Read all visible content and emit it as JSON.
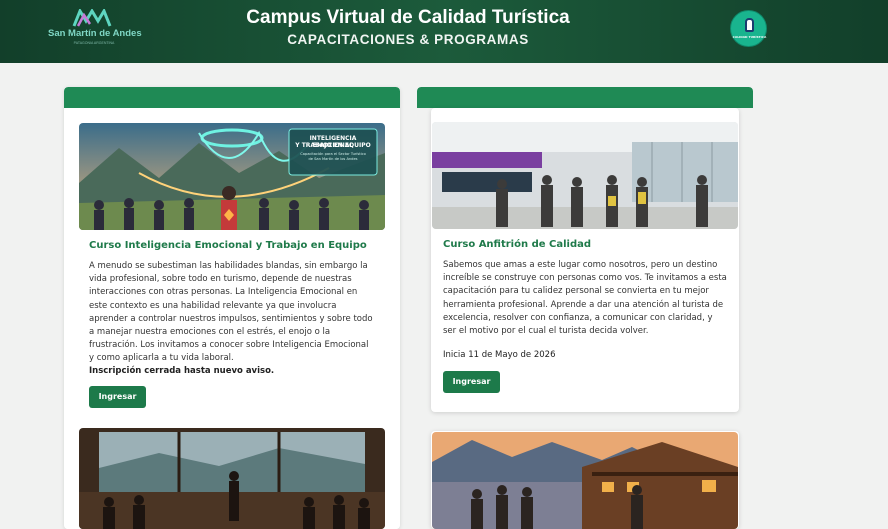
{
  "header": {
    "brand": "San Martín de Andes",
    "brand_sub": "PATAGONIA ARGENTINA",
    "title": "Campus Virtual de Calidad Turística",
    "subtitle": "CAPACITACIONES & PROGRAMAS",
    "badge_text": "CALIDAD TURÍSTICA"
  },
  "courses": [
    {
      "title": "Curso Inteligencia Emocional y Trabajo en Equipo",
      "image_banner_line1": "INTELIGENCIA EMOCIONAL",
      "image_banner_line2": "Y TRABAJO EN EQUIPO",
      "image_banner_line3": "Capacitación para el Sector Turístico",
      "image_banner_line4": "de San Martín de los Andes",
      "description": "A menudo se subestiman las habilidades blandas, sin embargo la vida profesional, sobre todo en turismo, depende de nuestras interacciones con otras personas. La Inteligencia Emocional en este contexto es una habilidad relevante ya que involucra aprender a controlar nuestros impulsos, sentimientos y sobre todo a manejar nuestra emociones con el estrés, el enojo o la frustración. Los invitamos a conocer sobre Inteligencia Emocional y como aplicarla a tu vida laboral.",
      "note": "Inscripción cerrada hasta nuevo aviso.",
      "button": "Ingresar"
    },
    {
      "title": "Curso Anfitrión de Calidad",
      "description": "Sabemos que amas a este lugar como nosotros, pero un destino increíble se construye con personas como vos. Te invitamos a esta capacitación para tu calidez personal se convierta en tu mejor herramienta profesional. Aprende a dar una atención al turista de excelencia, resolver con confianza, a comunicar con claridad, y ser el motivo por el cual el turista decida volver.",
      "note": "Inicia 11 de Mayo de 2026",
      "button": "Ingresar"
    }
  ],
  "colors": {
    "header_bg": "#1c5b3b",
    "accent": "#1f8a55",
    "button": "#1d7a4a",
    "title_text": "#1f7a4a"
  }
}
